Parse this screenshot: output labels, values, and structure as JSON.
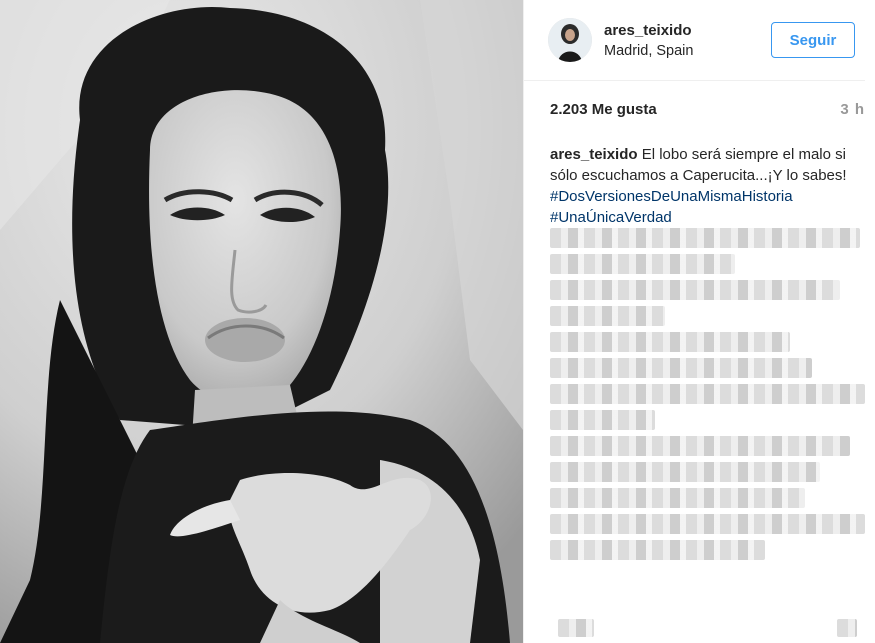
{
  "header": {
    "username": "ares_teixido",
    "location": "Madrid, Spain",
    "follow_label": "Seguir"
  },
  "meta": {
    "likes": "2.203 Me gusta",
    "time": "3 h"
  },
  "caption": {
    "username": "ares_teixido",
    "text": "El lobo será siempre el malo si sólo escuchamos a Caperucita...¡Y lo sabes!",
    "tags": [
      "#DosVersionesDeUnaMismaHistoria",
      "#UnaÚnicaVerdad"
    ]
  },
  "colors": {
    "accent": "#3897f0",
    "hashtag": "#003569",
    "divider": "#efefef"
  },
  "icons": {
    "avatar": "avatar-image"
  }
}
